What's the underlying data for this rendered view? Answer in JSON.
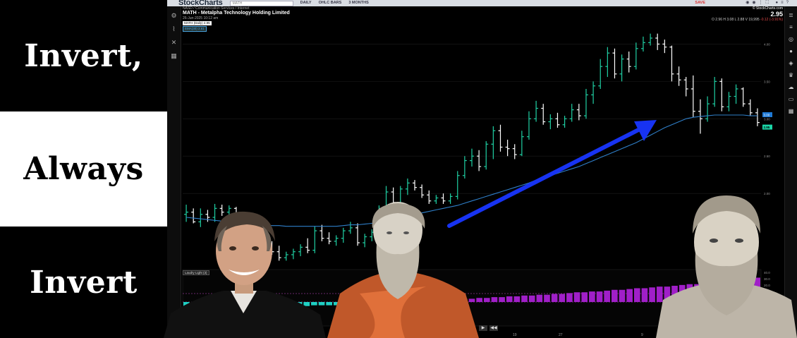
{
  "left_panel": {
    "line1": "Invert,",
    "line2": "Always",
    "line3": "Invert"
  },
  "toolbar": {
    "logo": "StockCharts",
    "search_value": "MATH",
    "period": "DAILY",
    "chart_type": "OHLC BARS",
    "range": "3 MONTHS",
    "save_label": "SAVE"
  },
  "chart_header": {
    "breadcrumb": "NASD / Communication Services / Internet",
    "title": "MATH - Metalpha Technology Holding Limited",
    "date": "26-Jun-2025 10:12 am",
    "legend_price": "MATH (Daily) 2.95",
    "legend_ema": "EMA(30) 2.61"
  },
  "quote": {
    "source": "© StockCharts.com",
    "last": "2.95",
    "ohlc": "O 2.96   H 3.08   L 2.88   V 19,995",
    "change": "-0.12 (-3.91%)"
  },
  "indicator": {
    "label": "Laudry Light (3)"
  },
  "chart_data": {
    "type": "ohlc",
    "y_ticks": [
      "4.00",
      "3.50",
      "3.00",
      "2.50",
      "2.00"
    ],
    "y_badges": [
      "3.00",
      "2.95"
    ],
    "x_ticks": [
      "19",
      "27",
      "9"
    ],
    "ind_ticks": [
      "40.0",
      "30.0",
      "20.0",
      "10.0",
      "0.0"
    ],
    "ind_badge": "1.00",
    "price_min": 1.0,
    "price_max": 4.25,
    "bars": [
      [
        1.72,
        1.85,
        1.62,
        1.75
      ],
      [
        1.75,
        1.8,
        1.6,
        1.62
      ],
      [
        1.62,
        1.8,
        1.55,
        1.72
      ],
      [
        1.72,
        1.78,
        1.62,
        1.68
      ],
      [
        1.68,
        1.86,
        1.62,
        1.8
      ],
      [
        1.8,
        1.85,
        1.7,
        1.75
      ],
      [
        1.75,
        1.84,
        1.66,
        1.8
      ],
      [
        1.8,
        1.82,
        1.48,
        1.52
      ],
      [
        1.52,
        1.62,
        1.42,
        1.48
      ],
      [
        1.48,
        1.55,
        1.28,
        1.32
      ],
      [
        1.32,
        1.4,
        1.18,
        1.22
      ],
      [
        1.22,
        1.35,
        1.15,
        1.3
      ],
      [
        1.3,
        1.36,
        1.18,
        1.22
      ],
      [
        1.22,
        1.3,
        1.1,
        1.14
      ],
      [
        1.14,
        1.22,
        1.1,
        1.18
      ],
      [
        1.18,
        1.26,
        1.12,
        1.22
      ],
      [
        1.22,
        1.32,
        1.16,
        1.28
      ],
      [
        1.28,
        1.4,
        1.2,
        1.24
      ],
      [
        1.24,
        1.56,
        1.2,
        1.5
      ],
      [
        1.5,
        1.58,
        1.36,
        1.4
      ],
      [
        1.4,
        1.48,
        1.32,
        1.36
      ],
      [
        1.36,
        1.44,
        1.3,
        1.4
      ],
      [
        1.4,
        1.54,
        1.34,
        1.5
      ],
      [
        1.5,
        1.62,
        1.46,
        1.54
      ],
      [
        1.54,
        1.6,
        1.3,
        1.34
      ],
      [
        1.34,
        1.46,
        1.28,
        1.42
      ],
      [
        1.42,
        1.52,
        1.36,
        1.48
      ],
      [
        1.48,
        1.84,
        1.44,
        1.8
      ],
      [
        1.8,
        2.1,
        1.76,
        2.02
      ],
      [
        2.02,
        2.08,
        1.84,
        1.88
      ],
      [
        1.88,
        2.1,
        1.82,
        2.06
      ],
      [
        2.06,
        2.2,
        1.98,
        2.14
      ],
      [
        2.14,
        2.18,
        2.04,
        2.08
      ],
      [
        2.08,
        2.12,
        1.94,
        1.98
      ],
      [
        1.98,
        2.04,
        1.86,
        1.9
      ],
      [
        1.9,
        1.98,
        1.86,
        1.94
      ],
      [
        1.94,
        2.0,
        1.86,
        1.9
      ],
      [
        1.9,
        2.0,
        1.86,
        1.96
      ],
      [
        1.96,
        2.3,
        1.92,
        2.24
      ],
      [
        2.24,
        2.5,
        2.2,
        2.44
      ],
      [
        2.44,
        2.6,
        2.36,
        2.5
      ],
      [
        2.5,
        2.58,
        2.3,
        2.36
      ],
      [
        2.36,
        2.7,
        2.32,
        2.66
      ],
      [
        2.66,
        2.9,
        2.46,
        2.84
      ],
      [
        2.84,
        2.92,
        2.56,
        2.62
      ],
      [
        2.62,
        2.72,
        2.5,
        2.6
      ],
      [
        2.6,
        2.66,
        2.46,
        2.52
      ],
      [
        2.52,
        2.84,
        2.5,
        2.76
      ],
      [
        2.76,
        3.1,
        2.72,
        3.0
      ],
      [
        3.0,
        3.24,
        2.96,
        3.14
      ],
      [
        3.14,
        3.2,
        2.92,
        2.96
      ],
      [
        2.96,
        3.06,
        2.86,
        3.0
      ],
      [
        3.0,
        3.08,
        2.88,
        2.92
      ],
      [
        2.92,
        3.04,
        2.88,
        3.0
      ],
      [
        3.0,
        3.2,
        2.96,
        3.12
      ],
      [
        3.12,
        3.2,
        2.98,
        3.04
      ],
      [
        3.04,
        3.4,
        3.0,
        3.32
      ],
      [
        3.32,
        3.5,
        3.2,
        3.44
      ],
      [
        3.44,
        3.8,
        3.4,
        3.7
      ],
      [
        3.7,
        3.96,
        3.56,
        3.88
      ],
      [
        3.88,
        3.94,
        3.54,
        3.6
      ],
      [
        3.6,
        3.86,
        3.5,
        3.8
      ],
      [
        3.8,
        3.9,
        3.62,
        3.7
      ],
      [
        3.7,
        4.02,
        3.66,
        3.94
      ],
      [
        3.94,
        4.1,
        3.9,
        4.02
      ],
      [
        4.02,
        4.14,
        3.98,
        4.08
      ],
      [
        4.08,
        4.14,
        3.92,
        4.0
      ],
      [
        4.0,
        4.06,
        3.88,
        3.96
      ],
      [
        3.96,
        3.98,
        3.5,
        3.6
      ],
      [
        3.6,
        3.7,
        3.44,
        3.52
      ],
      [
        3.52,
        3.56,
        3.3,
        3.4
      ],
      [
        3.4,
        3.58,
        3.02,
        3.1
      ],
      [
        3.1,
        3.26,
        2.8,
        3.0
      ],
      [
        3.0,
        3.3,
        2.96,
        3.2
      ],
      [
        3.2,
        3.56,
        3.16,
        3.5
      ],
      [
        3.5,
        3.54,
        3.1,
        3.16
      ],
      [
        3.16,
        3.36,
        3.1,
        3.3
      ],
      [
        3.3,
        3.46,
        3.2,
        3.4
      ],
      [
        3.4,
        3.42,
        3.16,
        3.2
      ],
      [
        3.2,
        3.26,
        3.04,
        3.08
      ],
      [
        3.08,
        3.14,
        2.9,
        2.95
      ]
    ],
    "ema": [
      1.68,
      1.67,
      1.66,
      1.65,
      1.64,
      1.63,
      1.62,
      1.61,
      1.6,
      1.59,
      1.58,
      1.58,
      1.57,
      1.57,
      1.56,
      1.56,
      1.56,
      1.56,
      1.56,
      1.56,
      1.56,
      1.56,
      1.57,
      1.58,
      1.58,
      1.59,
      1.6,
      1.62,
      1.64,
      1.66,
      1.68,
      1.7,
      1.72,
      1.74,
      1.76,
      1.78,
      1.8,
      1.82,
      1.84,
      1.87,
      1.9,
      1.93,
      1.96,
      1.99,
      2.02,
      2.05,
      2.08,
      2.11,
      2.14,
      2.18,
      2.21,
      2.24,
      2.27,
      2.3,
      2.33,
      2.36,
      2.4,
      2.44,
      2.48,
      2.52,
      2.56,
      2.6,
      2.64,
      2.68,
      2.73,
      2.78,
      2.83,
      2.88,
      2.92,
      2.96,
      3.0,
      3.02,
      3.03,
      3.04,
      3.05,
      3.05,
      3.05,
      3.05,
      3.05,
      3.04,
      3.04
    ],
    "histogram": [
      -8,
      -8,
      -8,
      -8,
      -8,
      -8,
      -7,
      -7,
      -7,
      -6,
      -6,
      -6,
      -6,
      -5,
      -5,
      -5,
      -5,
      -4,
      -4,
      -4,
      -4,
      -3,
      -3,
      -3,
      -3,
      -3,
      -2,
      -2,
      -2,
      -1,
      -1,
      1,
      1,
      2,
      2,
      3,
      3,
      4,
      4,
      5,
      5,
      6,
      6,
      7,
      7,
      8,
      8,
      9,
      9,
      10,
      10,
      11,
      12,
      12,
      13,
      13,
      14,
      15,
      15,
      16,
      17,
      17,
      18,
      19,
      19,
      20,
      21,
      22,
      22,
      23,
      24,
      25,
      26,
      27,
      28,
      29,
      30
    ]
  }
}
